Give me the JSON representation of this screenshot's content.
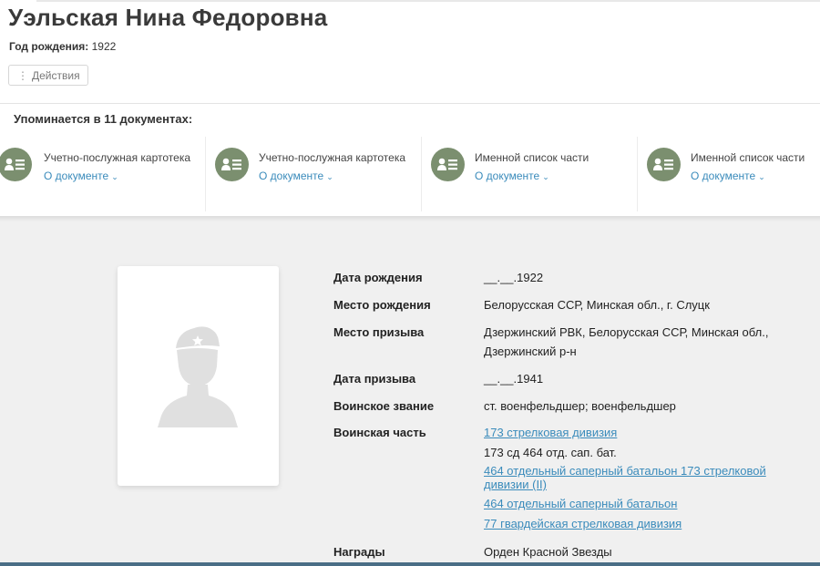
{
  "person": {
    "name": "Уэльская Нина Федоровна",
    "birth_year_label": "Год рождения:",
    "birth_year": "1922"
  },
  "actions": {
    "label": "Действия"
  },
  "mentions": {
    "label": "Упоминается в 11 документах:"
  },
  "documents": [
    {
      "title": "Учетно-послужная картотека",
      "link": "О документе",
      "icon": "people-list-icon"
    },
    {
      "title": "Учетно-послужная картотека",
      "link": "О документе",
      "icon": "people-list-icon"
    },
    {
      "title": "Именной список части",
      "link": "О документе",
      "icon": "people-list-icon"
    },
    {
      "title": "Именной список части",
      "link": "О документе",
      "icon": "people-list-icon"
    }
  ],
  "details": {
    "birth_date": {
      "label": "Дата рождения",
      "value": "__.__.1922"
    },
    "birth_place": {
      "label": "Место рождения",
      "value": "Белорусская ССР, Минская обл., г. Слуцк"
    },
    "draft_place": {
      "label": "Место призыва",
      "value_line1": "Дзержинский РВК, Белорусская ССР, Минская обл.,",
      "value_line2": "Дзержинский р-н"
    },
    "draft_date": {
      "label": "Дата призыва",
      "value": "__.__.1941"
    },
    "rank": {
      "label": "Воинское звание",
      "value": "ст. военфельдшер; военфельдшер"
    },
    "unit": {
      "label": "Воинская часть",
      "link1": "173 стрелковая дивизия",
      "text": "173 сд 464 отд. сап. бат.",
      "link2_line1": "464 отдельный саперный батальон 173 стрелковой",
      "link2_line2": "дивизии (II)",
      "link3": "464 отдельный саперный батальон",
      "link4": "77 гвардейская стрелковая дивизия"
    },
    "awards": {
      "label": "Награды",
      "value": "Орден Красной Звезды"
    }
  },
  "colors": {
    "accent_link": "#3a8bbb",
    "icon_green": "#7b8f6f",
    "background": "#f0f0f0"
  }
}
